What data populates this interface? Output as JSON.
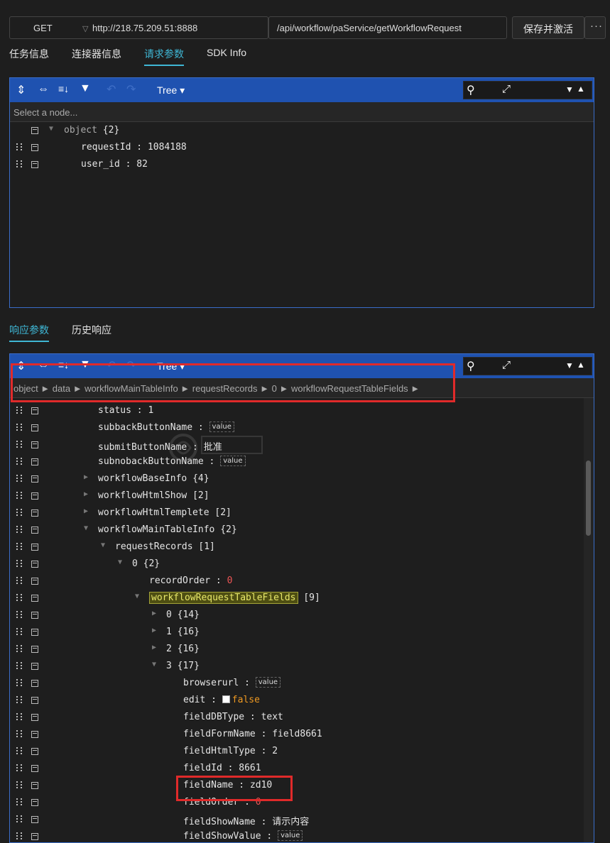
{
  "request": {
    "method": "GET",
    "host": "http://218.75.209.51:8888",
    "path": "/api/workflow/paService/getWorkflowRequest",
    "save_label": "保存并激活",
    "more_label": "···"
  },
  "top_tabs": [
    "任务信息",
    "连接器信息",
    "请求参数",
    "SDK Info"
  ],
  "request_editor": {
    "mode": "Tree",
    "nav_placeholder": "Select a node...",
    "root_label": "object",
    "root_count": "{2}",
    "rows": [
      {
        "key": "requestId",
        "value": "1084188"
      },
      {
        "key": "user_id",
        "value": "82"
      }
    ]
  },
  "bottom_tabs": [
    "响应参数",
    "历史响应"
  ],
  "response_editor": {
    "mode": "Tree",
    "breadcrumb": "object ► data ► workflowMainTableInfo ► requestRecords ► 0 ► workflowRequestTableFields ►",
    "rows": [
      {
        "key": "status",
        "value": "1"
      },
      {
        "key": "subbackButtonName",
        "value": "value"
      },
      {
        "key": "submitButtonName",
        "value": "批准"
      },
      {
        "key": "subnobackButtonName",
        "value": "value"
      },
      {
        "key": "workflowBaseInfo",
        "count": "{4}"
      },
      {
        "key": "workflowHtmlShow",
        "count": "[2]"
      },
      {
        "key": "workflowHtmlTemplete",
        "count": "[2]"
      },
      {
        "key": "workflowMainTableInfo",
        "count": "{2}"
      },
      {
        "key": "requestRecords",
        "count": "[1]"
      },
      {
        "key": "0",
        "count": "{2}"
      },
      {
        "key": "recordOrder",
        "value": "0"
      },
      {
        "key": "workflowRequestTableFields",
        "count": "[9]"
      },
      {
        "key": "0",
        "count": "{14}"
      },
      {
        "key": "1",
        "count": "{16}"
      },
      {
        "key": "2",
        "count": "{16}"
      },
      {
        "key": "3",
        "count": "{17}"
      },
      {
        "key": "browserurl",
        "value": "value"
      },
      {
        "key": "edit",
        "value": "false"
      },
      {
        "key": "fieldDBType",
        "value": "text"
      },
      {
        "key": "fieldFormName",
        "value": "field8661"
      },
      {
        "key": "fieldHtmlType",
        "value": "2"
      },
      {
        "key": "fieldId",
        "value": "8661"
      },
      {
        "key": "fieldName",
        "value": "zd10"
      },
      {
        "key": "fieldOrder",
        "value": "0"
      },
      {
        "key": "fieldShowName",
        "value": "请示内容"
      },
      {
        "key": "fieldShowValue",
        "value": "value"
      }
    ]
  },
  "colors": {
    "accent": "#3fb6d4",
    "toolbar": "#1f52b0",
    "highlight": "#e02a2a"
  },
  "icons": [
    "expand-all-icon",
    "collapse-all-icon",
    "sort-icon",
    "filter-icon",
    "undo-icon",
    "redo-icon",
    "search-icon",
    "fullscreen-icon",
    "prev-icon",
    "next-icon"
  ]
}
